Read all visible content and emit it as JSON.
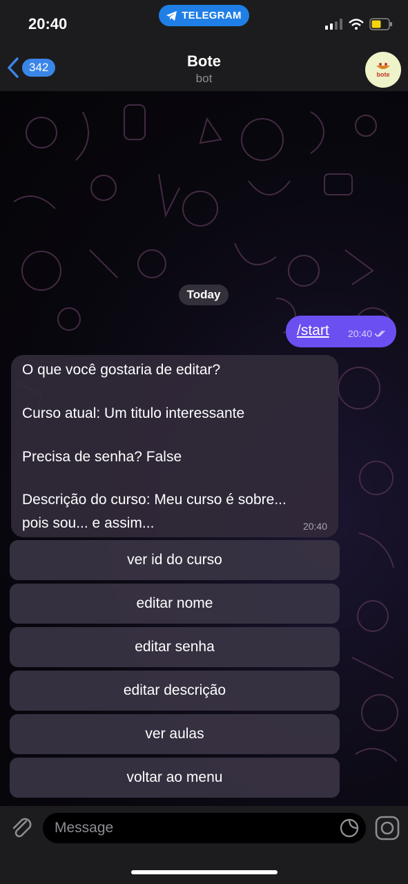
{
  "status_bar": {
    "time": "20:40",
    "pill_label": "TELEGRAM"
  },
  "header": {
    "back_count": "342",
    "title": "Bote",
    "subtitle": "bot",
    "avatar_text": "bote"
  },
  "chat": {
    "date_chip": "Today",
    "outgoing": {
      "text": "/start",
      "time": "20:40"
    },
    "incoming": {
      "lines": [
        "O que você gostaria de editar?",
        "Curso atual: Um titulo interessante",
        "Precisa de senha? False",
        "Descrição do curso: Meu curso é sobre...",
        "pois sou... e assim..."
      ],
      "time": "20:40"
    },
    "keyboard": [
      "ver id do curso",
      "editar nome",
      "editar senha",
      "editar descrição",
      "ver aulas",
      "voltar ao menu"
    ]
  },
  "composer": {
    "placeholder": "Message"
  },
  "icons": [
    "telegram-plane-icon",
    "signal-icon",
    "wifi-icon",
    "battery-icon",
    "chevron-left-icon",
    "double-check-icon",
    "attach-icon",
    "sticker-icon",
    "camera-icon"
  ],
  "colors": {
    "accent": "#3a86e8",
    "outgoing_bubble": "#6b4ff0",
    "battery": "#f5d30f"
  }
}
